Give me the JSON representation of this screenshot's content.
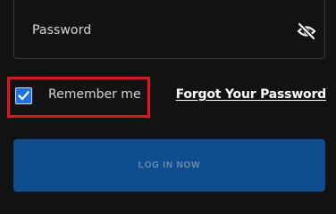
{
  "password_field": {
    "placeholder": "Password",
    "toggle_icon": "eye-slash-icon"
  },
  "remember": {
    "label": "Remember me",
    "checked": true,
    "highlight_color": "#e0151e",
    "checkbox_color": "#1a73e8"
  },
  "forgot": {
    "label": "Forgot Your Password"
  },
  "login": {
    "label": "LOG IN NOW",
    "button_color": "#0e4e8e"
  }
}
